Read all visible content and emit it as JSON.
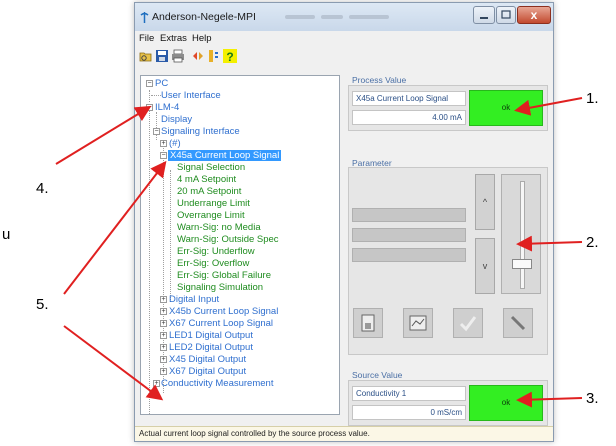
{
  "window": {
    "title": "Anderson-Negele-MPI",
    "close_glyph": "x"
  },
  "menu": [
    "File",
    "Extras",
    "Help"
  ],
  "toolbar_icons": [
    "open-icon",
    "save-icon",
    "print-icon",
    "connect-icon",
    "device-icon",
    "help-icon"
  ],
  "toolbar_help_glyph": "?",
  "tree": {
    "pc": "PC",
    "user_interface": "User Interface",
    "ilm": "ILM-4",
    "display": "Display",
    "signaling_interface": "Signaling Interface",
    "hash": "(#)",
    "x45a": "X45a Current Loop Signal",
    "children": [
      "Signal Selection",
      "4 mA Setpoint",
      "20 mA Setpoint",
      "Underrange Limit",
      "Overrange Limit",
      "Warn-Sig: no Media",
      "Warn-Sig: Outside Spec",
      "Err-Sig: Underflow",
      "Err-Sig: Overflow",
      "Err-Sig: Global Failure",
      "Signaling Simulation"
    ],
    "siblings": [
      "Digital Input",
      "X45b Current Loop Signal",
      "X67 Current Loop Signal",
      "LED1 Digital Output",
      "LED2 Digital Output",
      "X45 Digital Output",
      "X67 Digital Output"
    ],
    "conductivity": "Conductivity Measurement"
  },
  "process_value": {
    "label": "Process Value",
    "signal": "X45a Current Loop Signal",
    "value": "4.00 mA",
    "status": "ok"
  },
  "parameter": {
    "label": "Parameter",
    "up_glyph": "^",
    "down_glyph": "v"
  },
  "source_value": {
    "label": "Source Value",
    "signal": "Conductivity 1",
    "value": "0 mS/cm",
    "status": "ok"
  },
  "status_bar": {
    "text": "Actual current loop signal controlled by the source process value."
  },
  "annotations": {
    "n1": "1.",
    "n2": "2.",
    "n3": "3.",
    "n4": "4.",
    "n5": "5.",
    "stray": "u"
  },
  "colors": {
    "accent_blue": "#2f6fcf",
    "tree_green": "#1f8c1f",
    "ok_green": "#33ee22",
    "arrow_red": "#e02020",
    "selection": "#3399ff"
  }
}
